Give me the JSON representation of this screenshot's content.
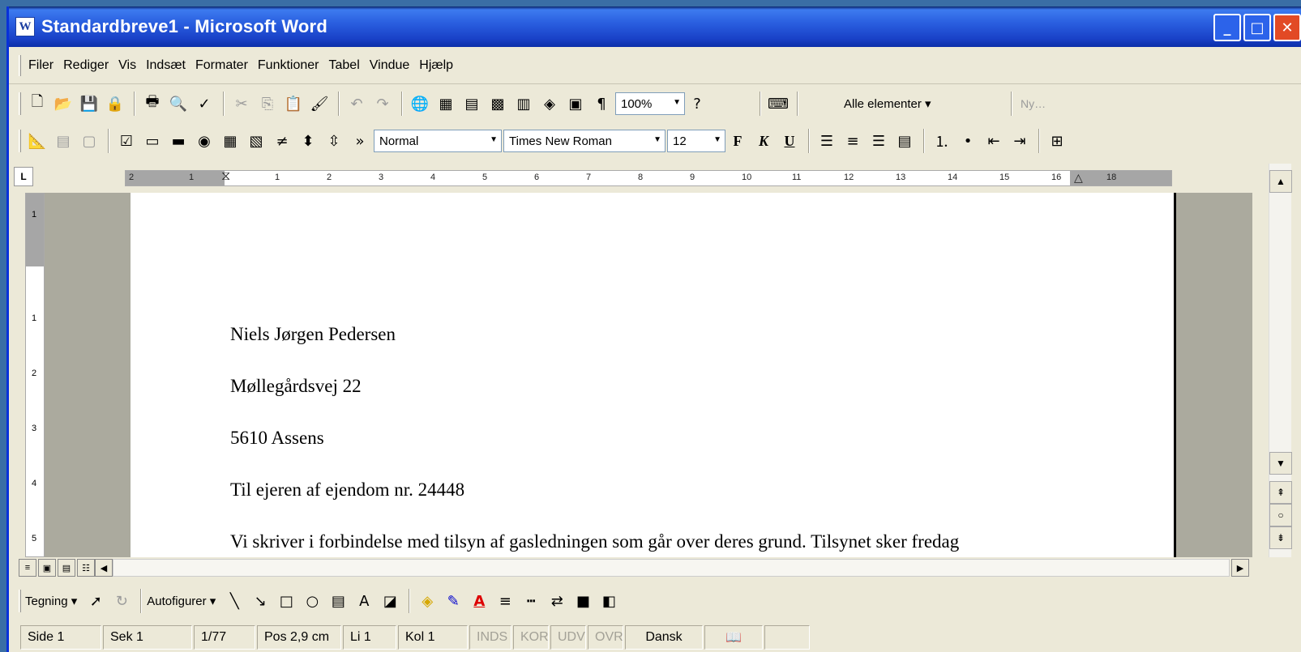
{
  "window": {
    "title": "Standardbreve1 - Microsoft Word",
    "app_icon": "W",
    "minimize": "_",
    "maximize": "□",
    "close": "✕"
  },
  "menu": [
    "Filer",
    "Rediger",
    "Vis",
    "Indsæt",
    "Formater",
    "Funktioner",
    "Tabel",
    "Vindue",
    "Hjælp"
  ],
  "standard_toolbar": {
    "zoom": "100%",
    "elements_dropdown": "Alle elementer ▾",
    "new_style": "Ny…"
  },
  "format_toolbar": {
    "style": "Normal",
    "font": "Times New Roman",
    "size": "12",
    "bold": "F",
    "italic": "K",
    "underline": "U"
  },
  "ruler": {
    "corner": "L",
    "ticks": [
      "2",
      "1",
      "1",
      "2",
      "3",
      "4",
      "5",
      "6",
      "7",
      "8",
      "9",
      "10",
      "11",
      "12",
      "13",
      "14",
      "15",
      "16",
      "18"
    ]
  },
  "vertical_ruler": {
    "ticks": [
      "1",
      "1",
      "2",
      "3",
      "4",
      "5"
    ]
  },
  "document": {
    "lines": [
      "Niels Jørgen Pedersen",
      "Møllegårdsvej 22",
      "5610 Assens",
      "Til ejeren af ejendom nr. 24448",
      "Vi skriver i forbindelse med tilsyn af gasledningen som går over deres grund. Tilsynet sker fredag"
    ]
  },
  "drawing_toolbar": {
    "drawing": "Tegning ▾",
    "autoshapes": "Autofigurer ▾"
  },
  "status": {
    "page": "Side 1",
    "section": "Sek 1",
    "pages": "1/77",
    "position": "Pos 2,9 cm",
    "line": "Li 1",
    "column": "Kol 1",
    "rec": "INDS",
    "trk": "KOR",
    "ext": "UDV",
    "ovr": "OVR",
    "language": "Dansk"
  }
}
